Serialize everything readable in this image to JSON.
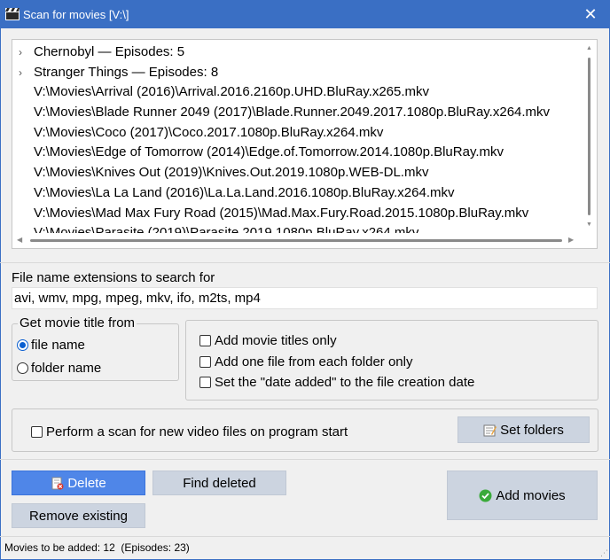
{
  "window": {
    "title": "Scan for movies [V:\\]",
    "close_glyph": "✕"
  },
  "tree": {
    "rows": [
      {
        "text": "Chernobyl — Episodes: 5",
        "expandable": true
      },
      {
        "text": "Stranger Things — Episodes: 8",
        "expandable": true
      },
      {
        "text": "V:\\Movies\\Arrival (2016)\\Arrival.2016.2160p.UHD.BluRay.x265.mkv",
        "expandable": false
      },
      {
        "text": "V:\\Movies\\Blade Runner 2049 (2017)\\Blade.Runner.2049.2017.1080p.BluRay.x264.mkv",
        "expandable": false
      },
      {
        "text": "V:\\Movies\\Coco (2017)\\Coco.2017.1080p.BluRay.x264.mkv",
        "expandable": false
      },
      {
        "text": "V:\\Movies\\Edge of Tomorrow (2014)\\Edge.of.Tomorrow.2014.1080p.BluRay.mkv",
        "expandable": false
      },
      {
        "text": "V:\\Movies\\Knives Out (2019)\\Knives.Out.2019.1080p.WEB-DL.mkv",
        "expandable": false
      },
      {
        "text": "V:\\Movies\\La La Land (2016)\\La.La.Land.2016.1080p.BluRay.x264.mkv",
        "expandable": false
      },
      {
        "text": "V:\\Movies\\Mad Max Fury Road (2015)\\Mad.Max.Fury.Road.2015.1080p.BluRay.mkv",
        "expandable": false
      },
      {
        "text": "V:\\Movies\\Parasite (2019)\\Parasite.2019.1080p.BluRay.x264.mkv",
        "expandable": false
      }
    ]
  },
  "extensions": {
    "label": "File name extensions to search for",
    "value": "avi, wmv, mpg, mpeg, mkv, ifo, m2ts, mp4"
  },
  "title_source": {
    "label": "Get movie title from",
    "options": [
      {
        "label": "file name",
        "selected": true
      },
      {
        "label": "folder name",
        "selected": false
      }
    ]
  },
  "options": {
    "add_titles_only": {
      "label": "Add movie titles only",
      "checked": false
    },
    "one_per_folder": {
      "label": "Add one file from each folder only",
      "checked": false
    },
    "date_added": {
      "label": "Set the \"date added\" to the file creation date",
      "checked": false
    }
  },
  "scan_on_start": {
    "label": "Perform a scan for new video files on program start",
    "checked": false
  },
  "buttons": {
    "set_folders": "Set folders",
    "delete": "Delete",
    "find_deleted": "Find deleted",
    "remove_existing": "Remove existing",
    "add_movies": "Add movies"
  },
  "status": {
    "text": "Movies to be added: 12  (Episodes: 23)"
  },
  "colors": {
    "titlebar": "#3a6fc4",
    "primary_button": "#4f86e8",
    "button": "#ccd4e0",
    "check_green": "#3aaa3a"
  }
}
